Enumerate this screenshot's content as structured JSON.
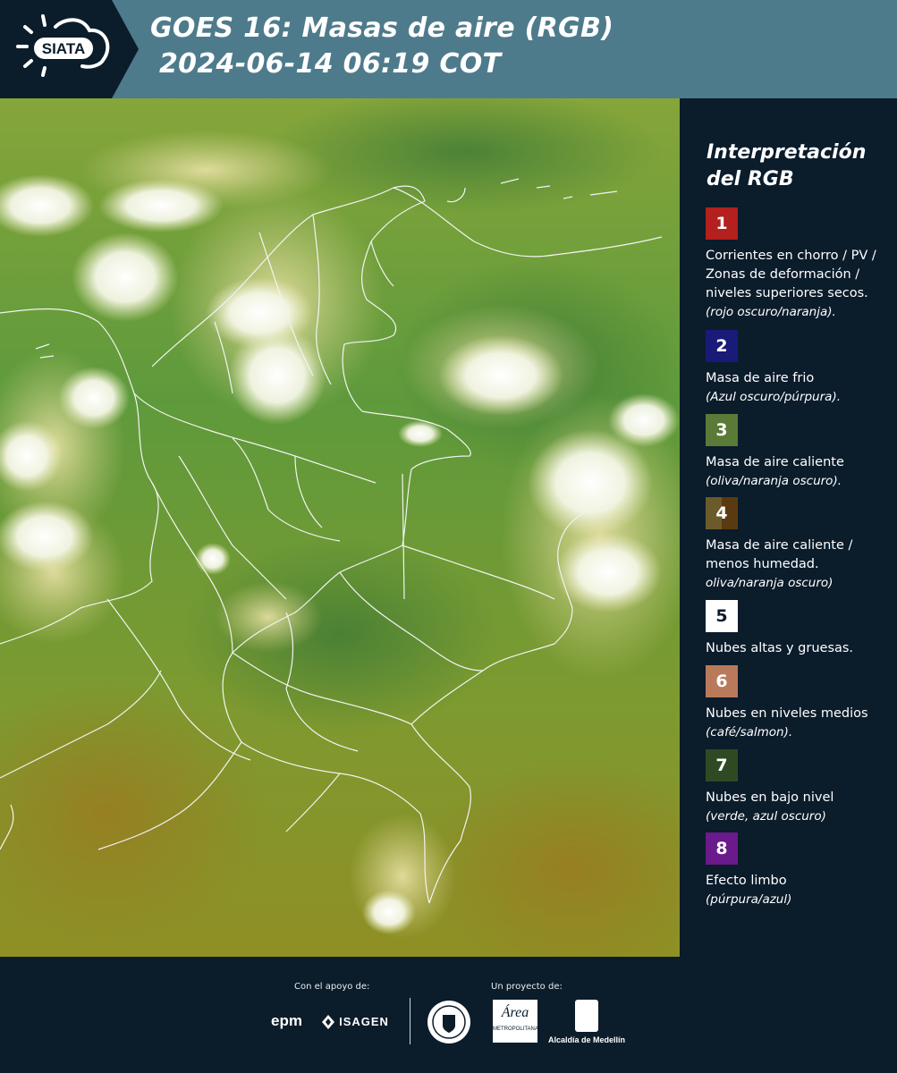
{
  "header": {
    "brand": "SIATA",
    "title_line1": "GOES 16: Masas de aire (RGB)",
    "title_line2": "2024-06-14 06:19 COT"
  },
  "legend": {
    "heading_line1": "Interpretación",
    "heading_line2": "del RGB",
    "items": [
      {
        "num": "1",
        "color": "#b3201e",
        "text": "Corrientes en chorro / PV / Zonas de deformación / niveles superiores secos.",
        "note": "(rojo oscuro/naranja)."
      },
      {
        "num": "2",
        "color": "#1a1a78",
        "text": "Masa de aire frio",
        "note": "(Azul oscuro/púrpura)."
      },
      {
        "num": "3",
        "color": "#5a7a38",
        "text": "Masa de aire caliente",
        "note": "(oliva/naranja oscuro)."
      },
      {
        "num": "4",
        "color": "#6b5a2a",
        "color2": "#5a3a10",
        "text": "Masa de aire caliente / menos humedad.",
        "note": "oliva/naranja oscuro)"
      },
      {
        "num": "5",
        "color": "#ffffff",
        "text": "Nubes altas y gruesas.",
        "note": ""
      },
      {
        "num": "6",
        "color": "#b97a5c",
        "text": "Nubes en niveles medios",
        "note": "(café/salmon)."
      },
      {
        "num": "7",
        "color": "#2f4a22",
        "text": "Nubes en bajo nivel",
        "note": "(verde, azul oscuro)"
      },
      {
        "num": "8",
        "color": "#6a1a8a",
        "text": "Efecto limbo",
        "note": "(púrpura/azul)"
      }
    ]
  },
  "footer": {
    "support_caption": "Con el apoyo de:",
    "project_caption": "Un proyecto de:",
    "sponsor_epm": "epm",
    "sponsor_isagen": "ISAGEN",
    "partner_area": "Área",
    "partner_area_sub": "METROPOLITANA",
    "partner_medellin": "Alcaldía de Medellín"
  }
}
